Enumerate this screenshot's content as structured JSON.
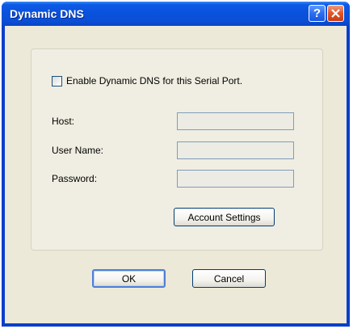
{
  "window": {
    "title": "Dynamic DNS",
    "help_glyph": "?",
    "close_glyph": "✕"
  },
  "form": {
    "enable_label": "Enable Dynamic DNS for this Serial Port.",
    "enable_checked": false,
    "host_label": "Host:",
    "host_value": "",
    "username_label": "User Name:",
    "username_value": "",
    "password_label": "Password:",
    "password_value": "",
    "account_settings_label": "Account Settings"
  },
  "buttons": {
    "ok_label": "OK",
    "cancel_label": "Cancel"
  },
  "colors": {
    "titlebar": "#0a52dc",
    "client": "#ece9d8",
    "close": "#e0552a"
  },
  "icons": {
    "help": "help-icon",
    "close": "close-icon"
  }
}
